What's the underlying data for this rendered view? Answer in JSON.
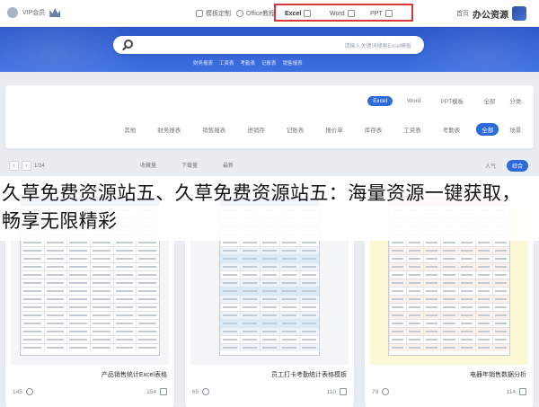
{
  "top_bar": {
    "vip_label": "VIP会员",
    "nav": [
      {
        "label": "模板定制",
        "icon": "pen-icon"
      },
      {
        "label": "Office教程",
        "icon": "play-icon"
      }
    ],
    "tabs": [
      {
        "label": "Excel",
        "icon": "grid-icon",
        "active": true
      },
      {
        "label": "Word",
        "icon": "doc-icon"
      },
      {
        "label": "PPT",
        "icon": "slides-icon"
      }
    ],
    "home_label": "首页",
    "logo_text": "办公资源"
  },
  "search": {
    "placeholder": "请输入关键词搜索Excel模板",
    "hot_words": [
      "财务报表",
      "工资表",
      "考勤表",
      "记账表",
      "销售报表"
    ]
  },
  "filter": {
    "category_label": "分类:",
    "type_tabs": [
      {
        "label": "全部"
      },
      {
        "label": "PPT模板"
      },
      {
        "label": "Word"
      },
      {
        "label": "Excel",
        "active": true
      }
    ],
    "scene_label": "场景:",
    "scenes": [
      {
        "label": "全部",
        "active": true
      },
      {
        "label": "考勤表"
      },
      {
        "label": "工资表"
      },
      {
        "label": "库存表"
      },
      {
        "label": "报价单"
      },
      {
        "label": "记账表"
      },
      {
        "label": "进销存"
      },
      {
        "label": "销售报表"
      },
      {
        "label": "财务报表"
      },
      {
        "label": "其他"
      }
    ]
  },
  "toolbar": {
    "page": "1/34",
    "sorts": [
      {
        "label": "综合",
        "active": true
      },
      {
        "label": "最新"
      },
      {
        "label": "下载量"
      },
      {
        "label": "收藏量"
      }
    ],
    "right_items": [
      "人气",
      "最新"
    ]
  },
  "cards": [
    {
      "title": "产品销售统计Excel表格",
      "downloads": "154",
      "likes": "145"
    },
    {
      "title": "员工打卡考勤统计表格模板",
      "downloads": "110",
      "likes": "65"
    },
    {
      "title": "电器年销售数据分析",
      "downloads": "114",
      "likes": "79"
    }
  ],
  "overlay": {
    "text": "久草免费资源站五、久草免费资源站五：海量资源一键获取，畅享无限精彩"
  }
}
